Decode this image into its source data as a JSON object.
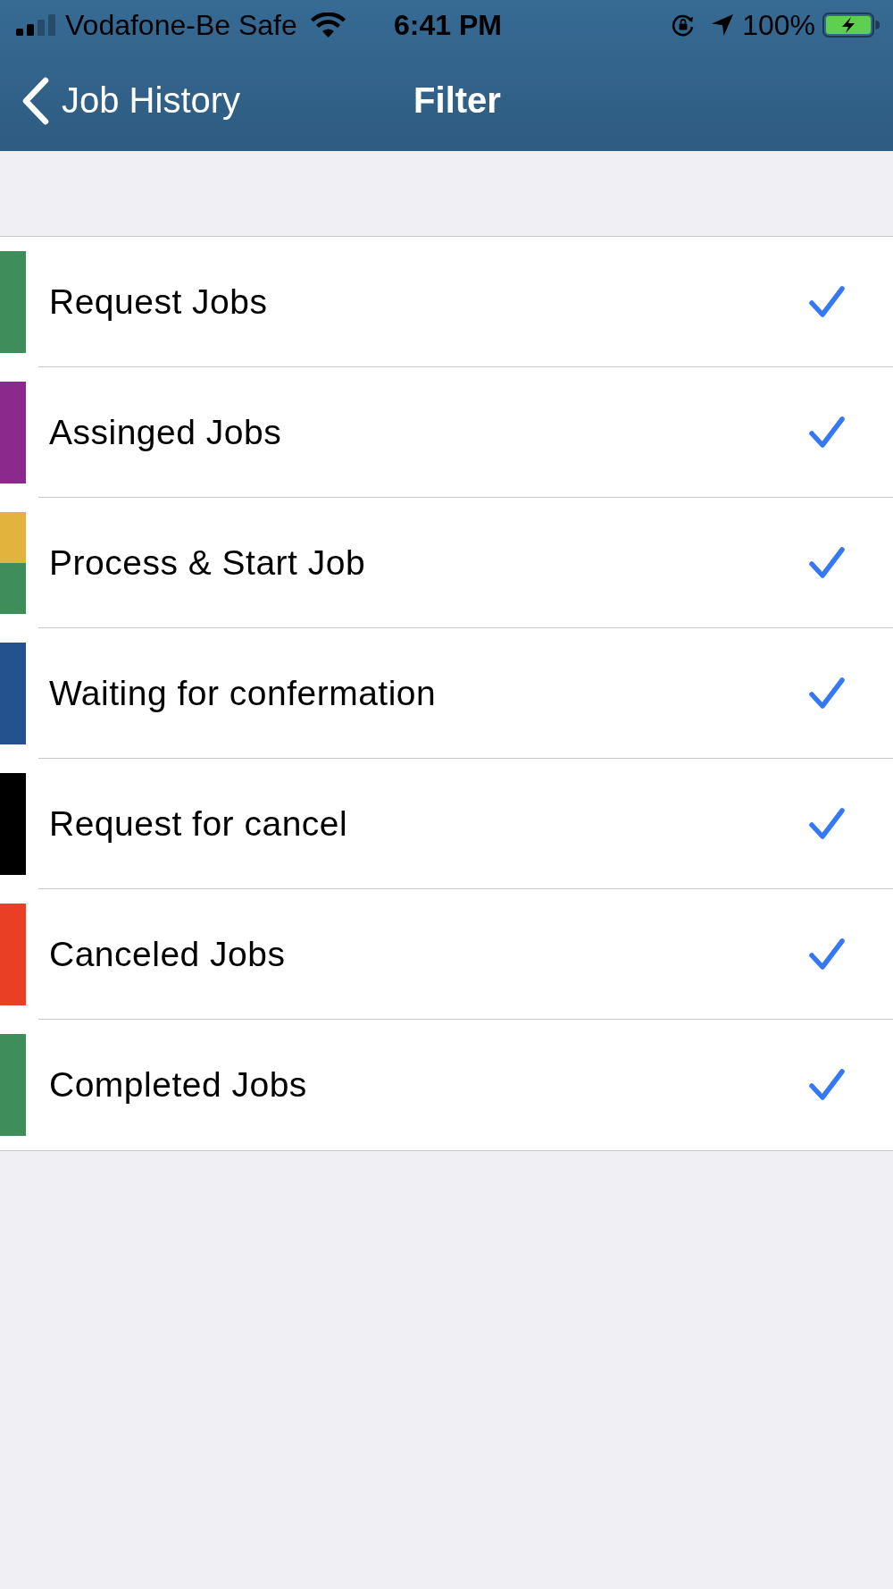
{
  "status_bar": {
    "carrier": "Vodafone-Be Safe",
    "time": "6:41 PM",
    "battery": "100%"
  },
  "nav_bar": {
    "back_label": "Job History",
    "title": "Filter"
  },
  "filters": [
    {
      "label": "Request Jobs",
      "checked": true,
      "bands": [
        {
          "color": "#3e8d5b"
        }
      ]
    },
    {
      "label": "Assinged Jobs",
      "checked": true,
      "bands": [
        {
          "color": "#8a2a8c"
        }
      ]
    },
    {
      "label": "Process & Start Job",
      "checked": true,
      "bands": [
        {
          "color": "#e2b43d"
        },
        {
          "color": "#3e8d5b"
        }
      ]
    },
    {
      "label": "Waiting for confermation",
      "checked": true,
      "bands": [
        {
          "color": "#23528f"
        }
      ]
    },
    {
      "label": "Request for cancel",
      "checked": true,
      "bands": [
        {
          "color": "#000000"
        }
      ]
    },
    {
      "label": "Canceled Jobs",
      "checked": true,
      "bands": [
        {
          "color": "#e94025"
        }
      ]
    },
    {
      "label": "Completed Jobs",
      "checked": true,
      "bands": [
        {
          "color": "#3e8d5b"
        }
      ]
    }
  ]
}
